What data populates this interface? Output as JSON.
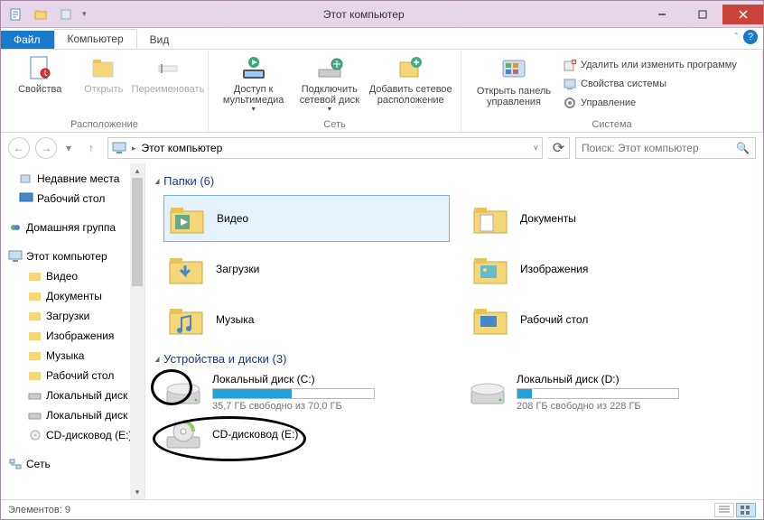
{
  "window": {
    "title": "Этот компьютер"
  },
  "tabs": {
    "file": "Файл",
    "computer": "Компьютер",
    "view": "Вид"
  },
  "ribbon": {
    "location": {
      "label": "Расположение",
      "properties": "Свойства",
      "open": "Открыть",
      "rename": "Переименовать"
    },
    "network": {
      "label": "Сеть",
      "media": "Доступ к мультимедиа",
      "map_drive": "Подключить сетевой диск",
      "add_location": "Добавить сетевое расположение"
    },
    "system": {
      "label": "Система",
      "control_panel": "Открыть панель управления",
      "uninstall": "Удалить или изменить программу",
      "sys_props": "Свойства системы",
      "manage": "Управление"
    }
  },
  "breadcrumb": {
    "current": "Этот компьютер"
  },
  "search": {
    "placeholder": "Поиск: Этот компьютер"
  },
  "sidebar": {
    "recent": "Недавние места",
    "desktop": "Рабочий стол",
    "homegroup": "Домашняя группа",
    "this_pc": "Этот компьютер",
    "videos": "Видео",
    "documents": "Документы",
    "downloads": "Загрузки",
    "pictures": "Изображения",
    "music": "Музыка",
    "desk2": "Рабочий стол",
    "local1": "Локальный диск (C:)",
    "local2": "Локальный диск (D:)",
    "cd": "CD-дисковод (E:)",
    "network": "Сеть"
  },
  "sections": {
    "folders": "Папки (6)",
    "drives": "Устройства и диски (3)"
  },
  "folders": {
    "videos": "Видео",
    "documents": "Документы",
    "downloads": "Загрузки",
    "pictures": "Изображения",
    "music": "Музыка",
    "desktop": "Рабочий стол"
  },
  "drives": {
    "c": {
      "name": "Локальный диск (C:)",
      "free": "35,7 ГБ свободно из 70,0 ГБ",
      "pct": 49
    },
    "d": {
      "name": "Локальный диск (D:)",
      "free": "208 ГБ свободно из 228 ГБ",
      "pct": 9
    },
    "e": {
      "name": "CD-дисковод (E:)"
    }
  },
  "status": {
    "items": "Элементов: 9"
  }
}
